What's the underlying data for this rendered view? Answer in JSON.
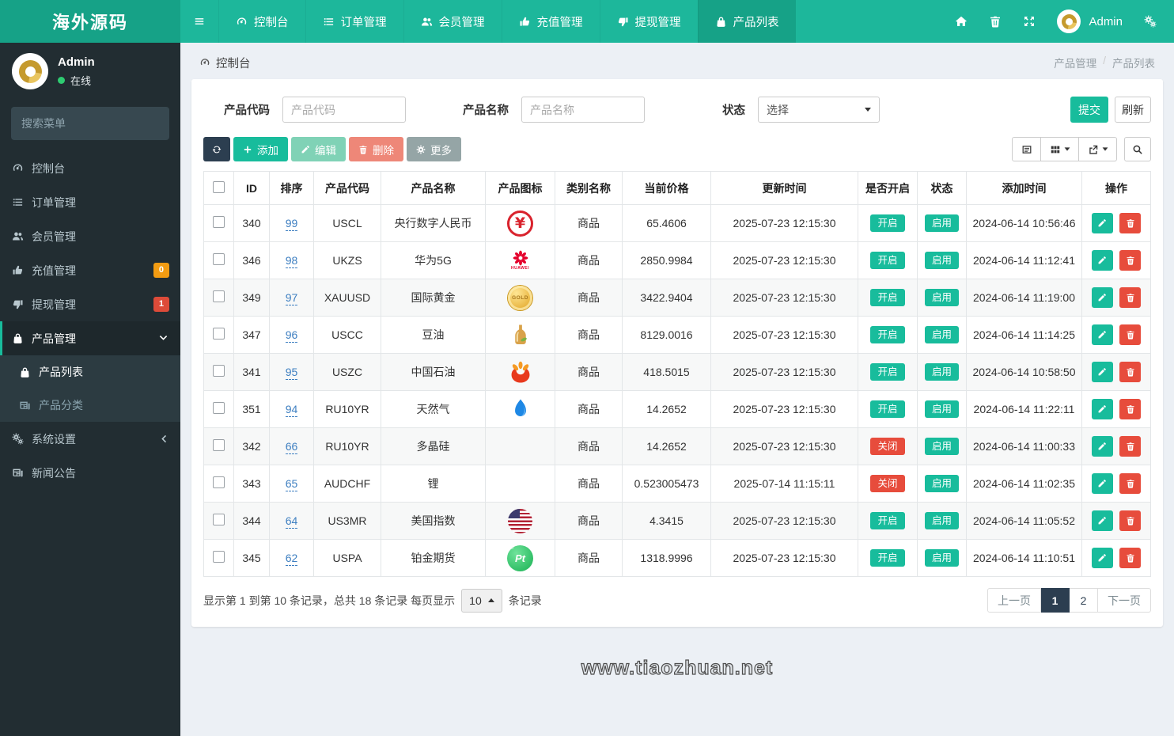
{
  "brand": {
    "title": "海外源码"
  },
  "topnav": {
    "items": [
      {
        "label": "控制台",
        "icon": "dashboard",
        "active": false
      },
      {
        "label": "订单管理",
        "icon": "list",
        "active": false
      },
      {
        "label": "会员管理",
        "icon": "users",
        "active": false
      },
      {
        "label": "充值管理",
        "icon": "thumb-up",
        "active": false
      },
      {
        "label": "提现管理",
        "icon": "thumb-down",
        "active": false
      },
      {
        "label": "产品列表",
        "icon": "bag",
        "active": true
      }
    ],
    "user_name": "Admin"
  },
  "sidebar": {
    "user_name": "Admin",
    "user_status": "在线",
    "search_placeholder": "搜索菜单",
    "items": [
      {
        "label": "控制台",
        "icon": "dashboard"
      },
      {
        "label": "订单管理",
        "icon": "list"
      },
      {
        "label": "会员管理",
        "icon": "users"
      },
      {
        "label": "充值管理",
        "icon": "thumb-up",
        "badge": "0",
        "badge_color": "#f39c12"
      },
      {
        "label": "提现管理",
        "icon": "thumb-down",
        "badge": "1",
        "badge_color": "#dd4b39"
      },
      {
        "label": "产品管理",
        "icon": "bag",
        "active": true,
        "expanded": true
      },
      {
        "label": "系统设置",
        "icon": "gears",
        "collapsed": true
      },
      {
        "label": "新闻公告",
        "icon": "news"
      }
    ],
    "submenu": [
      {
        "label": "产品列表",
        "icon": "bag",
        "active": true
      },
      {
        "label": "产品分类",
        "icon": "news",
        "active": false
      }
    ]
  },
  "breadcrumb": {
    "section": "控制台",
    "trail_1": "产品管理",
    "trail_2": "产品列表",
    "separator": "/"
  },
  "filters": {
    "code_label": "产品代码",
    "code_placeholder": "产品代码",
    "name_label": "产品名称",
    "name_placeholder": "产品名称",
    "status_label": "状态",
    "status_value": "选择",
    "submit_label": "提交",
    "refresh_label": "刷新"
  },
  "toolbar": {
    "add_label": "添加",
    "edit_label": "编辑",
    "delete_label": "删除",
    "more_label": "更多"
  },
  "table": {
    "columns": [
      "ID",
      "排序",
      "产品代码",
      "产品名称",
      "产品图标",
      "类别名称",
      "当前价格",
      "更新时间",
      "是否开启",
      "状态",
      "添加时间",
      "操作"
    ],
    "badge_open": "开启",
    "badge_closed": "关闭",
    "badge_enabled": "启用",
    "rows": [
      {
        "id": "340",
        "sort": "99",
        "code": "USCL",
        "name": "央行数字人民币",
        "icon": "pboc-yuan",
        "category": "商品",
        "price": "65.4606",
        "updated": "2025-07-23 12:15:30",
        "open": "开启",
        "status": "启用",
        "added": "2024-06-14 10:56:46"
      },
      {
        "id": "346",
        "sort": "98",
        "code": "UKZS",
        "name": "华为5G",
        "icon": "huawei",
        "category": "商品",
        "price": "2850.9984",
        "updated": "2025-07-23 12:15:30",
        "open": "开启",
        "status": "启用",
        "added": "2024-06-14 11:12:41"
      },
      {
        "id": "349",
        "sort": "97",
        "code": "XAUUSD",
        "name": "国际黄金",
        "icon": "gold-coin",
        "category": "商品",
        "price": "3422.9404",
        "updated": "2025-07-23 12:15:30",
        "open": "开启",
        "status": "启用",
        "added": "2024-06-14 11:19:00"
      },
      {
        "id": "347",
        "sort": "96",
        "code": "USCC",
        "name": "豆油",
        "icon": "oil-bottle",
        "category": "商品",
        "price": "8129.0016",
        "updated": "2025-07-23 12:15:30",
        "open": "开启",
        "status": "启用",
        "added": "2024-06-14 11:14:25"
      },
      {
        "id": "341",
        "sort": "95",
        "code": "USZC",
        "name": "中国石油",
        "icon": "petrochina",
        "category": "商品",
        "price": "418.5015",
        "updated": "2025-07-23 12:15:30",
        "open": "开启",
        "status": "启用",
        "added": "2024-06-14 10:58:50"
      },
      {
        "id": "351",
        "sort": "94",
        "code": "RU10YR",
        "name": "天然气",
        "icon": "gas-flame",
        "category": "商品",
        "price": "14.2652",
        "updated": "2025-07-23 12:15:30",
        "open": "开启",
        "status": "启用",
        "added": "2024-06-14 11:22:11"
      },
      {
        "id": "342",
        "sort": "66",
        "code": "RU10YR",
        "name": "多晶硅",
        "icon": null,
        "category": "商品",
        "price": "14.2652",
        "updated": "2025-07-23 12:15:30",
        "open": "关闭",
        "status": "启用",
        "added": "2024-06-14 11:00:33"
      },
      {
        "id": "343",
        "sort": "65",
        "code": "AUDCHF",
        "name": "锂",
        "icon": null,
        "category": "商品",
        "price": "0.523005473",
        "updated": "2025-07-14 11:15:11",
        "open": "关闭",
        "status": "启用",
        "added": "2024-06-14 11:02:35"
      },
      {
        "id": "344",
        "sort": "64",
        "code": "US3MR",
        "name": "美国指数",
        "icon": "us-flag",
        "category": "商品",
        "price": "4.3415",
        "updated": "2025-07-23 12:15:30",
        "open": "开启",
        "status": "启用",
        "added": "2024-06-14 11:05:52"
      },
      {
        "id": "345",
        "sort": "62",
        "code": "USPA",
        "name": "铂金期货",
        "icon": "platinum",
        "category": "商品",
        "price": "1318.9996",
        "updated": "2025-07-23 12:15:30",
        "open": "开启",
        "status": "启用",
        "added": "2024-06-14 11:10:51"
      }
    ]
  },
  "pagination": {
    "info_prefix": "显示第 1 到第 10 条记录，总共 18 条记录 每页显示",
    "page_size": "10",
    "info_suffix": "条记录",
    "prev_label": "上一页",
    "pages": [
      "1",
      "2"
    ],
    "active_page": "1",
    "next_label": "下一页"
  },
  "watermark": "www.tiaozhuan.net",
  "colors": {
    "navbar": "#1db79b",
    "navbar_dark": "#16a287",
    "sidebar": "#222d32",
    "accent": "#18bc9c",
    "danger": "#e74c3c",
    "warning": "#f39c12",
    "dark": "#2c3e50",
    "content_bg": "#ecf0f5"
  }
}
